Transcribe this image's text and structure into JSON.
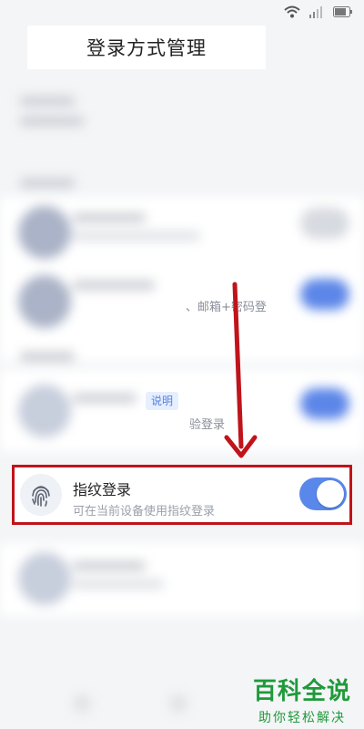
{
  "header": {
    "title": "登录方式管理"
  },
  "hints": {
    "email_password_fragment": "、邮箱+密码登",
    "tag_fragment": "说明",
    "verify_fragment": "验登录"
  },
  "fingerprint": {
    "title": "指纹登录",
    "subtitle": "可在当前设备使用指纹登录",
    "enabled": true
  },
  "watermark": {
    "main": "百科全说",
    "sub": "助你轻松解决"
  },
  "colors": {
    "accent": "#5a88ea",
    "highlight": "#c0141b",
    "watermark": "#1f9a3a"
  }
}
